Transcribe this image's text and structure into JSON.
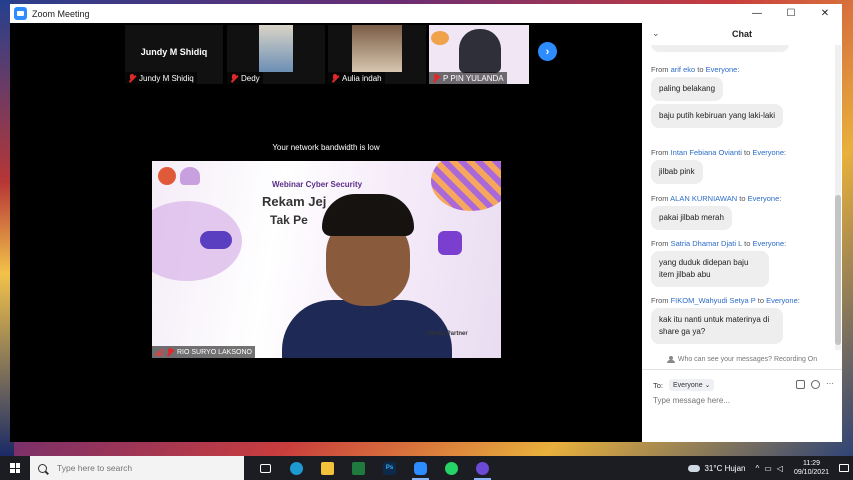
{
  "window": {
    "title": "Zoom Meeting",
    "controls": [
      "—",
      "☐",
      "✕"
    ]
  },
  "video": {
    "tiles": [
      {
        "name": "Jundy M Shidiq",
        "big_name": "Jundy M Shidiq",
        "muted": true
      },
      {
        "name": "Dedy",
        "muted": true
      },
      {
        "name": "Aulia indah",
        "muted": true
      },
      {
        "name": "P PIN YULANDA",
        "muted": true
      }
    ],
    "bandwidth_message": "Your network bandwidth is low",
    "main_speaker": {
      "name": "RIO SURYO LAKSONO",
      "slide_label": "Webinar Cyber Security",
      "slide_heading_1": "Rekam Jej",
      "slide_heading_2": "Tak Pe",
      "media_partner": "Media Partner"
    }
  },
  "chat": {
    "title": "Chat",
    "messages": [
      {
        "sender": "arif eko",
        "target": "Everyone",
        "texts": [
          "paling belakang",
          "baju putih kebiruan yang laki-laki"
        ]
      },
      {
        "sender": "Intan Febiana Ovianti",
        "target": "Everyone",
        "texts": [
          "jilbab pink"
        ]
      },
      {
        "sender": "ALAN KURNIAWAN",
        "target": "Everyone",
        "texts": [
          "pakai jilbab merah"
        ]
      },
      {
        "sender": "Satria Dhamar Djati L",
        "target": "Everyone",
        "texts": [
          "yang duduk didepan baju item jilbab abu"
        ]
      },
      {
        "sender": "FIKOM_Wahyudi Setya P",
        "target": "Everyone",
        "texts": [
          "kak itu nanti untuk materinya di share ga ya?"
        ]
      }
    ],
    "from_word": "From",
    "to_word": "to",
    "visibility_note": "Who can see your messages? Recording On",
    "to_label": "To:",
    "to_value": "Everyone",
    "input_placeholder": "Type message here..."
  },
  "taskbar": {
    "search_placeholder": "Type here to search",
    "weather": "31°C  Hujan",
    "time": "11:29",
    "date": "09/10/2021",
    "apps": [
      "task-view",
      "edge",
      "file-explorer",
      "excel-like",
      "photoshop",
      "zoom",
      "whatsapp",
      "zoom-meeting"
    ]
  },
  "colors": {
    "zoom_blue": "#2d8cff",
    "link_blue": "#2d6cc9",
    "muted_red": "#e02828"
  }
}
